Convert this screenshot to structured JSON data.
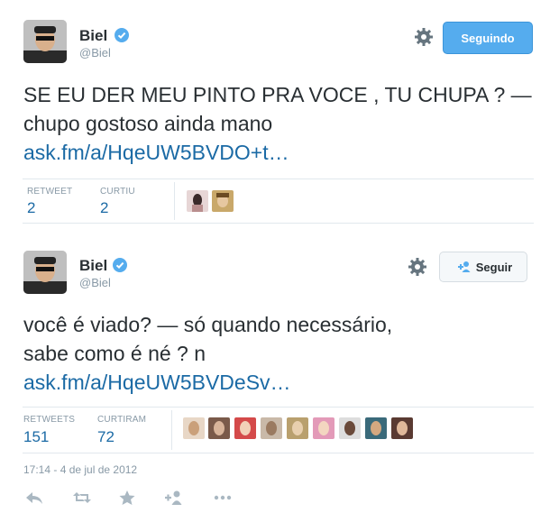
{
  "colors": {
    "accent": "#55acee",
    "link": "#1b6aa5",
    "muted": "#8899a6"
  },
  "tweets": [
    {
      "name": "Biel",
      "handle": "@Biel",
      "follow_label": "Seguindo",
      "text_main": "SE EU DER MEU PINTO PRA VOCE , TU CHUPA ? — chupo gostoso ainda mano",
      "text_link": "ask.fm/a/HqeUW5BVDO+t…",
      "stat1_label": "RETWEET",
      "stat1_value": "2",
      "stat2_label": "CURTIU",
      "stat2_value": "2"
    },
    {
      "name": "Biel",
      "handle": "@Biel",
      "follow_label": "Seguir",
      "text_line1": "você é viado? — só quando necessário,",
      "text_line2": "sabe como é né ? n",
      "text_link": "ask.fm/a/HqeUW5BVDeSv…",
      "stat1_label": "RETWEETS",
      "stat1_value": "151",
      "stat2_label": "CURTIRAM",
      "stat2_value": "72",
      "timestamp": "17:14 - 4 de jul de 2012"
    }
  ],
  "icons": {
    "verified": "verified-badge-icon",
    "gear": "gear-icon",
    "follow": "follow-person-icon",
    "reply": "reply-icon",
    "retweet": "retweet-icon",
    "favorite": "favorite-star-icon",
    "follow_action": "add-person-icon",
    "more": "more-dots-icon"
  }
}
